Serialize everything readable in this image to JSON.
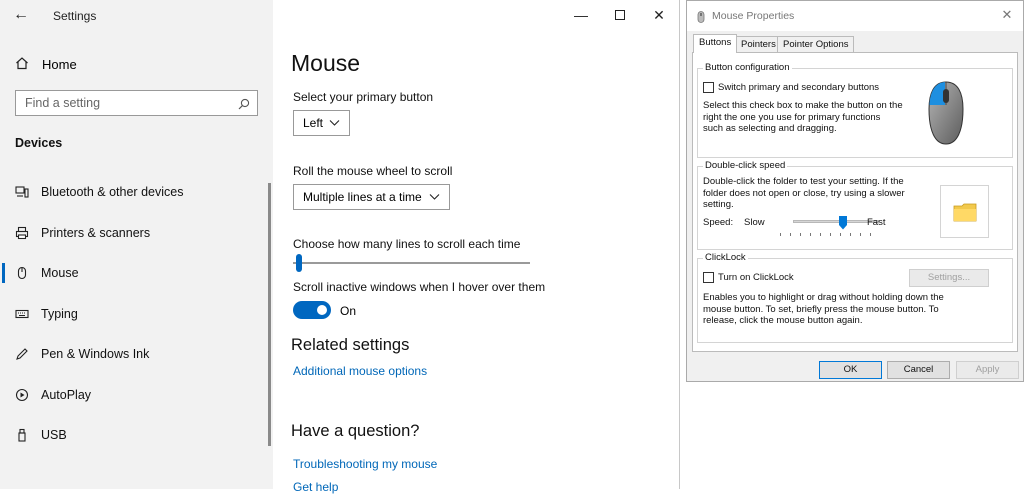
{
  "settings": {
    "app_title": "Settings",
    "home_label": "Home",
    "search_placeholder": "Find a setting",
    "section_title": "Devices",
    "nav": [
      {
        "label": "Bluetooth & other devices",
        "icon": "bluetooth-devices-icon"
      },
      {
        "label": "Printers & scanners",
        "icon": "printer-icon"
      },
      {
        "label": "Mouse",
        "icon": "mouse-icon",
        "selected": true
      },
      {
        "label": "Typing",
        "icon": "keyboard-icon"
      },
      {
        "label": "Pen & Windows Ink",
        "icon": "pen-icon"
      },
      {
        "label": "AutoPlay",
        "icon": "autoplay-icon"
      },
      {
        "label": "USB",
        "icon": "usb-icon"
      }
    ],
    "accent_color": "#0067c0"
  },
  "mouse_page": {
    "title": "Mouse",
    "primary_button_label": "Select your primary button",
    "primary_button_value": "Left",
    "scroll_wheel_label": "Roll the mouse wheel to scroll",
    "scroll_wheel_value": "Multiple lines at a time",
    "lines_label": "Choose how many lines to scroll each time",
    "inactive_label": "Scroll inactive windows when I hover over them",
    "inactive_state": "On",
    "related_heading": "Related settings",
    "related_link": "Additional mouse options",
    "question_heading": "Have a question?",
    "question_link_1": "Troubleshooting my mouse",
    "question_link_2": "Get help",
    "link_color": "#0067b8"
  },
  "dialog": {
    "title": "Mouse Properties",
    "tabs": [
      "Buttons",
      "Pointers",
      "Pointer Options"
    ],
    "button_config": {
      "group_title": "Button configuration",
      "checkbox_label": "Switch primary and secondary buttons",
      "description": "Select this check box to make the button on the right the one you use for primary functions such as selecting and dragging.",
      "checked": false
    },
    "double_click": {
      "group_title": "Double-click speed",
      "description": "Double-click the folder to test your setting. If the folder does not open or close, try using a slower setting.",
      "speed_label": "Speed:",
      "slow_label": "Slow",
      "fast_label": "Fast"
    },
    "clicklock": {
      "group_title": "ClickLock",
      "checkbox_label": "Turn on ClickLock",
      "settings_button": "Settings...",
      "description": "Enables you to highlight or drag without holding down the mouse button. To set, briefly press the mouse button. To release, click the mouse button again.",
      "checked": false
    },
    "ok_label": "OK",
    "cancel_label": "Cancel",
    "apply_label": "Apply"
  }
}
